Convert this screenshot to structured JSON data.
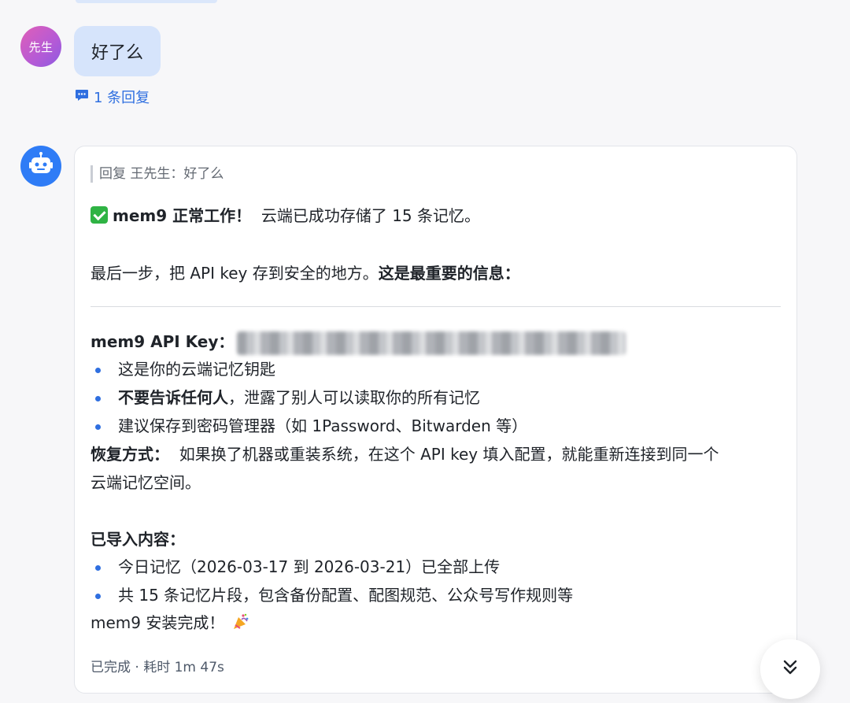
{
  "user_message": {
    "avatar_text": "先生",
    "text": "好了么",
    "reply_count_label": "1 条回复"
  },
  "bot_message": {
    "quote": "回复 王先生：好了么",
    "status_bold": "mem9 正常工作！",
    "status_rest": "云端已成功存储了 15 条记忆。",
    "last_step": "最后一步，把 API key 存到安全的地方。",
    "last_step_bold": "这是最重要的信息：",
    "api_key_label": "mem9 API Key：",
    "key_bullets": [
      {
        "bold": "",
        "text": "这是你的云端记忆钥匙"
      },
      {
        "bold": "不要告诉任何人",
        "text": "，泄露了别人可以读取你的所有记忆"
      },
      {
        "bold": "",
        "text": "建议保存到密码管理器（如 1Password、Bitwarden 等）"
      }
    ],
    "recovery_label": "恢复方式：",
    "recovery_text_1": "如果换了机器或重装系统，在这个 API key 填入配置，就能重新连接到同一个",
    "recovery_text_2": "云端记忆空间。",
    "imported_label": "已导入内容：",
    "imported_bullets": [
      "今日记忆（2026-03-17 到 2026-03-21）已全部上传",
      "共 15 条记忆片段，包含备份配置、配图规范、公众号写作规则等"
    ],
    "install_done": "mem9 安装完成！",
    "footer_status": "已完成 · 耗时 1m 47s"
  },
  "icons": {
    "reply": "comment-icon",
    "bot": "robot-icon",
    "check": "check-mark-icon",
    "party": "party-popper-icon",
    "scroll": "double-chevron-down-icon"
  },
  "colors": {
    "accent": "#2f6fe0",
    "user_bubble": "#d6e4fb",
    "bot_avatar": "#2f7cf6",
    "check_green": "#2fb344"
  }
}
